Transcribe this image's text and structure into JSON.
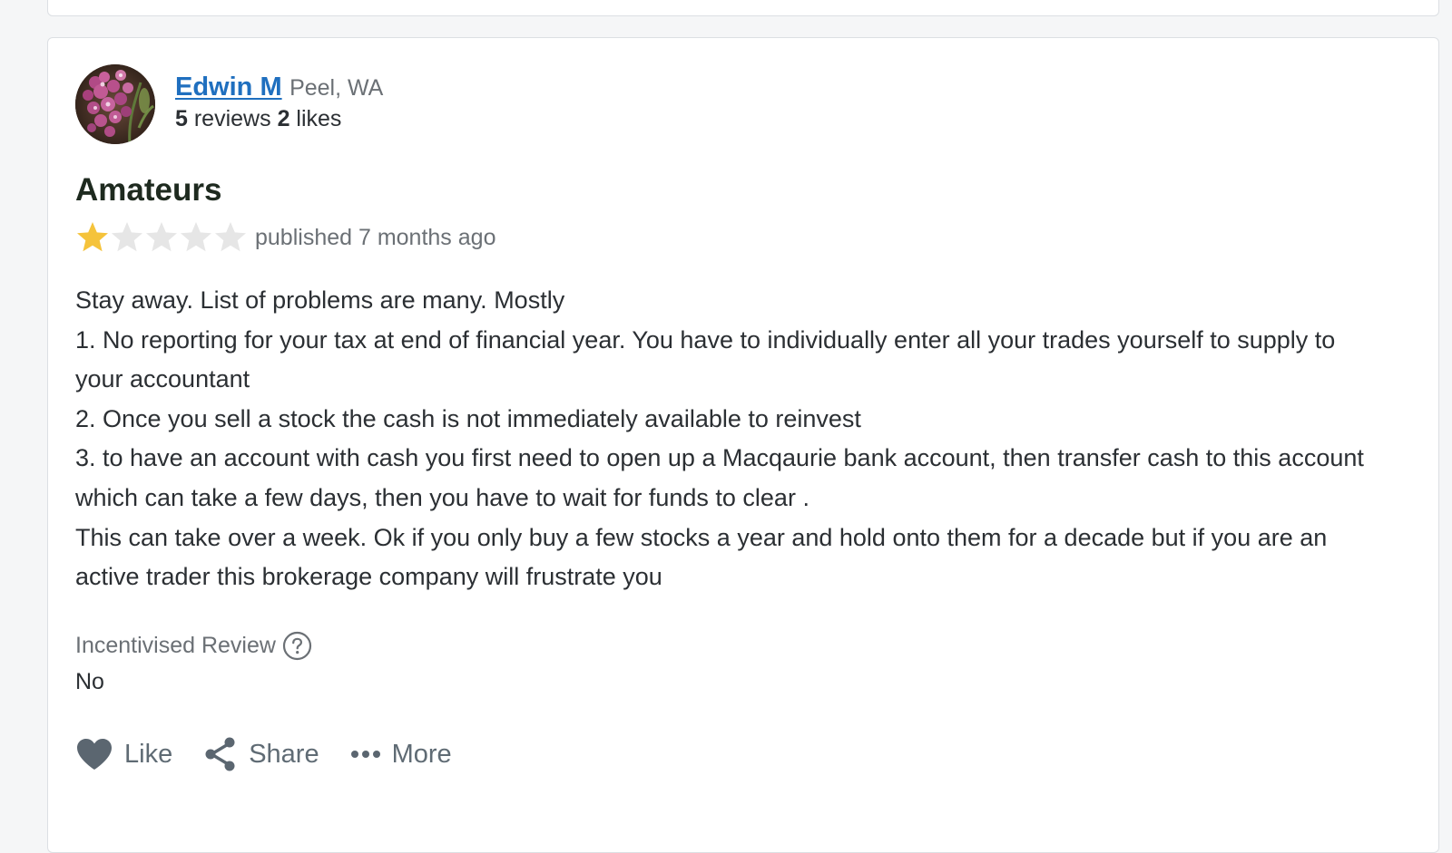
{
  "user": {
    "name": "Edwin M",
    "location": "Peel, WA",
    "reviews_count": "5",
    "reviews_label": "reviews",
    "likes_count": "2",
    "likes_label": "likes"
  },
  "review": {
    "title": "Amateurs",
    "rating": 1,
    "rating_max": 5,
    "published": "published 7 months ago",
    "body": [
      "Stay away. List of problems are many. Mostly",
      "1. No reporting for your tax at end of financial year. You have to individually enter all your trades yourself to supply to your accountant",
      "2. Once you sell a stock the cash is not immediately available to reinvest",
      "3. to have an account with cash you first need to open up a Macqaurie bank account, then transfer cash to this account which can take a few days, then you have to wait for funds to clear .",
      "This can take over a week. Ok if you only buy a few stocks a year and hold onto them for a decade but if you are an active trader this brokerage company will frustrate you"
    ],
    "incentivised_label": "Incentivised Review",
    "incentivised_value": "No"
  },
  "actions": {
    "like": "Like",
    "share": "Share",
    "more": "More"
  },
  "colors": {
    "star_filled": "#f5c33b",
    "star_empty": "#e6e6e6",
    "link": "#1f6fbf",
    "muted": "#6b7075"
  }
}
